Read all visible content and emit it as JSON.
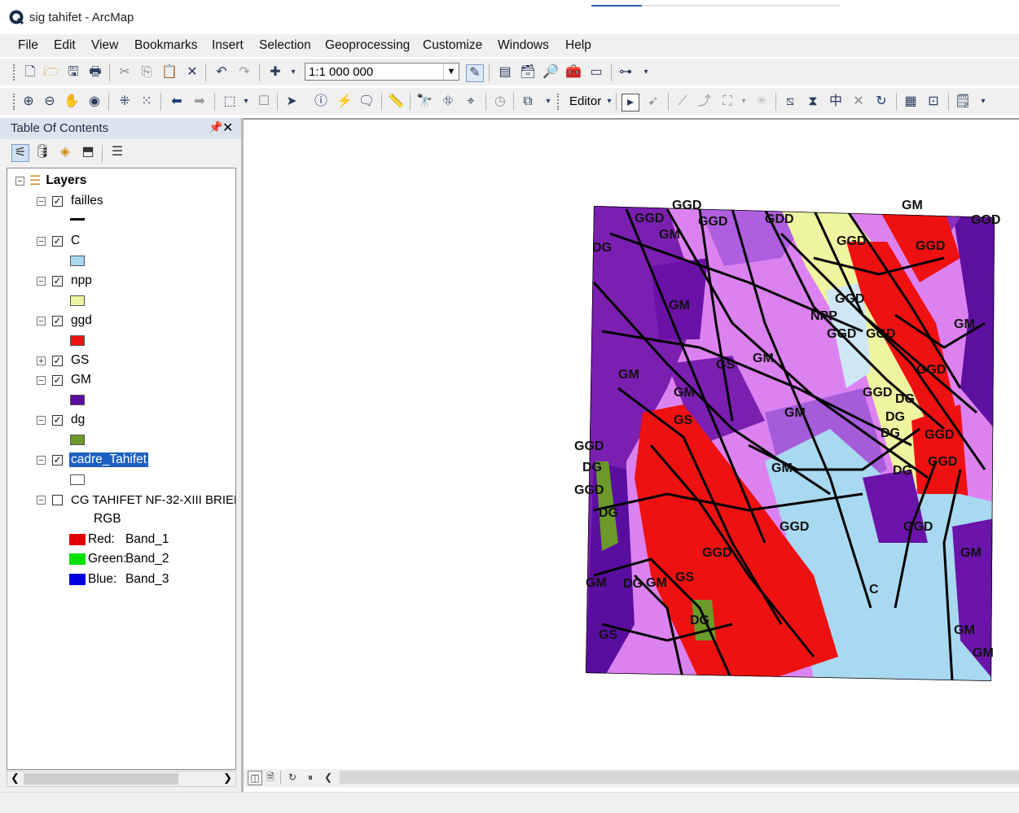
{
  "window": {
    "title": "sig tahifet - ArcMap"
  },
  "menu": [
    "File",
    "Edit",
    "View",
    "Bookmarks",
    "Insert",
    "Selection",
    "Geoprocessing",
    "Customize",
    "Windows",
    "Help"
  ],
  "toolbar": {
    "scale": "1:1 000 000",
    "editor_label": "Editor"
  },
  "toc": {
    "title": "Table Of Contents",
    "layers_group": "Layers",
    "layers": [
      {
        "name": "failles",
        "checked": true,
        "expanded": true,
        "symbol": "line",
        "color": "#000000"
      },
      {
        "name": "C",
        "checked": true,
        "expanded": true,
        "symbol": "fill",
        "color": "#a9d8f1"
      },
      {
        "name": "npp",
        "checked": true,
        "expanded": true,
        "symbol": "fill",
        "color": "#eef5a0"
      },
      {
        "name": "ggd",
        "checked": true,
        "expanded": true,
        "symbol": "fill",
        "color": "#ee1111"
      },
      {
        "name": "GS",
        "checked": true,
        "expanded": false
      },
      {
        "name": "GM",
        "checked": true,
        "expanded": true,
        "symbol": "fill",
        "color": "#5a0ea0"
      },
      {
        "name": "dg",
        "checked": true,
        "expanded": true,
        "symbol": "fill",
        "color": "#6b9a2a"
      },
      {
        "name": "cadre_Tahifet",
        "checked": true,
        "expanded": true,
        "selected": true,
        "symbol": "fill",
        "color": "#ffffff"
      },
      {
        "name": "CG TAHIFET NF-32-XIII BRIED.",
        "checked": false,
        "expanded": true
      }
    ],
    "raster": {
      "renderer": "RGB",
      "bands": [
        {
          "label": "Red:",
          "band": "Band_1",
          "color": "#e00000"
        },
        {
          "label": "Green:",
          "band": "Band_2",
          "color": "#00e000"
        },
        {
          "label": "Blue:",
          "band": "Band_3",
          "color": "#0000e0"
        }
      ]
    }
  },
  "map": {
    "labels": [
      "GGD",
      "GGD",
      "GGD",
      "GM",
      "GDD",
      "GGD",
      "GGD",
      "GGD",
      "GM",
      "DG",
      "GM",
      "NPP",
      "GGD",
      "GGD",
      "GM",
      "GS",
      "GM",
      "GGD",
      "GM",
      "GM",
      "GS",
      "GGD",
      "DG",
      "GM",
      "GGD",
      "DG",
      "DG",
      "GGD",
      "DG",
      "GGD",
      "DG",
      "GGD",
      "GGD",
      "GM",
      "GS",
      "GGD",
      "GM",
      "GM",
      "DG",
      "C",
      "GM",
      "GS",
      "GM",
      "DG",
      "GGD",
      "DG",
      "GM",
      "GGD"
    ]
  }
}
